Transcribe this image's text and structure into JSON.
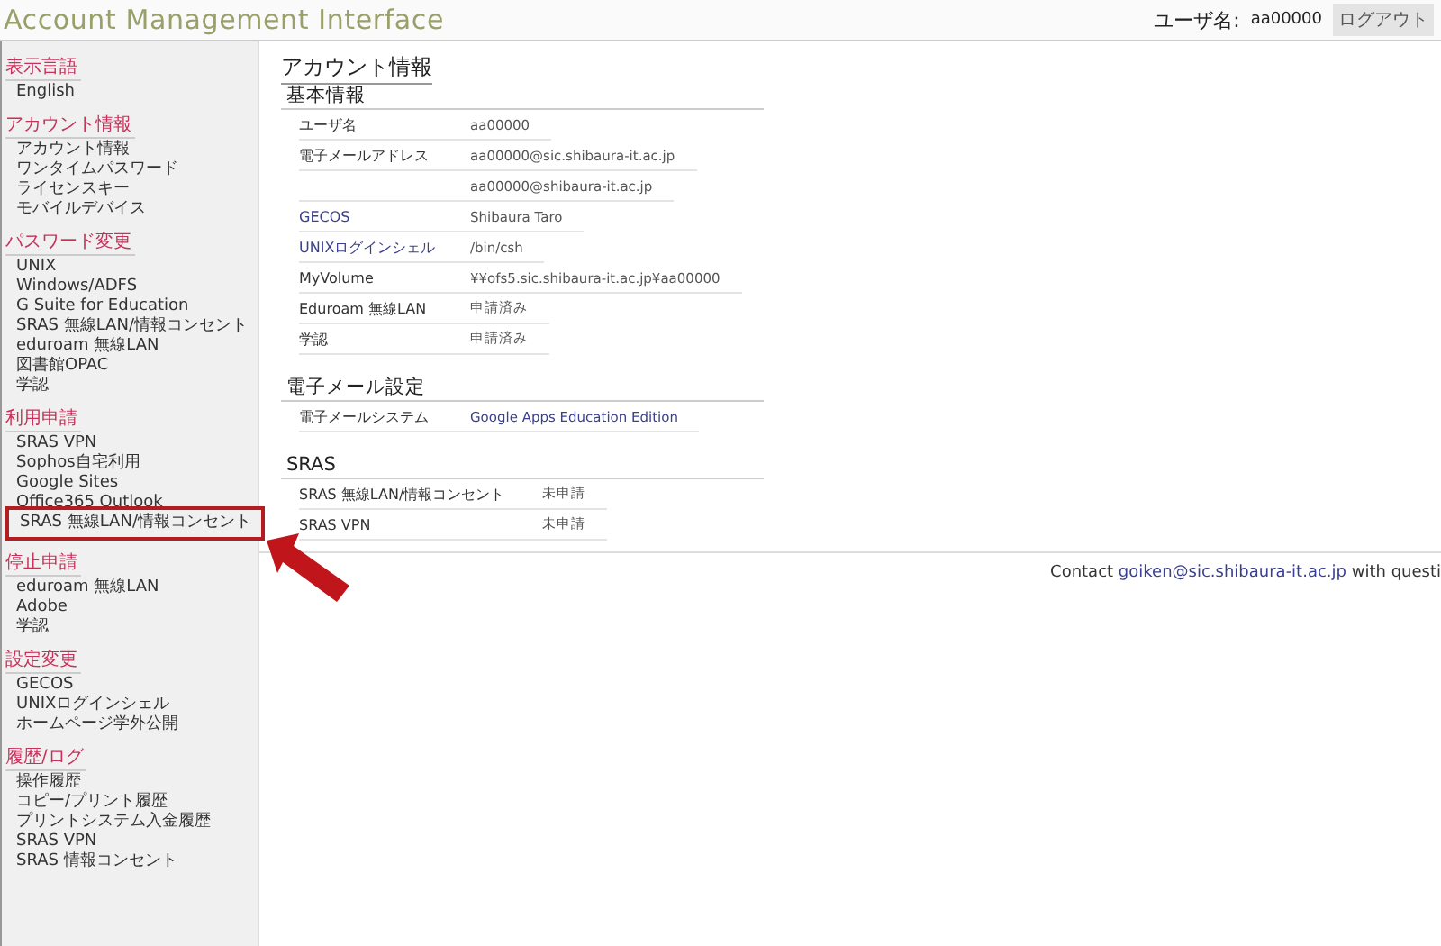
{
  "header": {
    "title": "Account Management Interface",
    "user_label": "ユーザ名:",
    "user_value": "aa00000",
    "logout": "ログアウト"
  },
  "sidebar": {
    "sections": [
      {
        "heading": "表示言語",
        "items": [
          {
            "label": "English",
            "highlighted": false
          }
        ]
      },
      {
        "heading": "アカウント情報",
        "items": [
          {
            "label": "アカウント情報",
            "highlighted": false
          },
          {
            "label": "ワンタイムパスワード",
            "highlighted": false
          },
          {
            "label": "ライセンスキー",
            "highlighted": false
          },
          {
            "label": "モバイルデバイス",
            "highlighted": false
          }
        ]
      },
      {
        "heading": "パスワード変更",
        "items": [
          {
            "label": "UNIX",
            "highlighted": false
          },
          {
            "label": "Windows/ADFS",
            "highlighted": false
          },
          {
            "label": "G Suite for Education",
            "highlighted": false
          },
          {
            "label": "SRAS 無線LAN/情報コンセント",
            "highlighted": false
          },
          {
            "label": "eduroam 無線LAN",
            "highlighted": false
          },
          {
            "label": "図書館OPAC",
            "highlighted": false
          },
          {
            "label": "学認",
            "highlighted": false
          }
        ]
      },
      {
        "heading": "利用申請",
        "items": [
          {
            "label": "SRAS VPN",
            "highlighted": false
          },
          {
            "label": "Sophos自宅利用",
            "highlighted": false
          },
          {
            "label": "Google Sites",
            "highlighted": false
          },
          {
            "label": "Office365 Outlook",
            "highlighted": false
          },
          {
            "label": "SRAS 無線LAN/情報コンセント",
            "highlighted": true
          }
        ]
      },
      {
        "heading": "停止申請",
        "items": [
          {
            "label": "eduroam 無線LAN",
            "highlighted": false
          },
          {
            "label": "Adobe",
            "highlighted": false
          },
          {
            "label": "学認",
            "highlighted": false
          }
        ]
      },
      {
        "heading": "設定変更",
        "items": [
          {
            "label": "GECOS",
            "highlighted": false
          },
          {
            "label": "UNIXログインシェル",
            "highlighted": false
          },
          {
            "label": "ホームページ学外公開",
            "highlighted": false
          }
        ]
      },
      {
        "heading": "履歴/ログ",
        "items": [
          {
            "label": "操作履歴",
            "highlighted": false
          },
          {
            "label": "コピー/プリント履歴",
            "highlighted": false
          },
          {
            "label": "プリントシステム入金履歴",
            "highlighted": false
          },
          {
            "label": "SRAS VPN",
            "highlighted": false
          },
          {
            "label": "SRAS 情報コンセント",
            "highlighted": false
          }
        ]
      }
    ]
  },
  "main": {
    "title": "アカウント情報",
    "sections": [
      {
        "heading": "基本情報",
        "rows": [
          {
            "label": "ユーザ名",
            "value": "aa00000",
            "label_link": false,
            "value_link": false
          },
          {
            "label": "電子メールアドレス",
            "value": "aa00000@sic.shibaura-it.ac.jp",
            "label_link": false,
            "value_link": false
          },
          {
            "value": "aa00000@shibaura-it.ac.jp",
            "value_link": false
          },
          {
            "label": "GECOS",
            "value": "Shibaura Taro",
            "label_link": true,
            "value_link": false
          },
          {
            "label": "UNIXログインシェル",
            "value": "/bin/csh",
            "label_link": true,
            "value_link": false
          },
          {
            "label": "MyVolume",
            "value": "¥¥ofs5.sic.shibaura-it.ac.jp¥aa00000",
            "label_link": false,
            "value_link": false
          },
          {
            "label": "Eduroam 無線LAN",
            "value": "申請済み",
            "label_link": false,
            "value_link": false
          },
          {
            "label": "学認",
            "value": "申請済み",
            "label_link": false,
            "value_link": false
          }
        ]
      },
      {
        "heading": "電子メール設定",
        "rows": [
          {
            "label": "電子メールシステム",
            "value": "Google Apps Education Edition",
            "label_link": false,
            "value_link": true
          }
        ]
      },
      {
        "heading": "SRAS",
        "rows": [
          {
            "label": "SRAS 無線LAN/情報コンセント",
            "value": "未申請",
            "label_link": false,
            "value_link": false
          },
          {
            "label": "SRAS VPN",
            "value": "未申請",
            "label_link": false,
            "value_link": false
          }
        ]
      }
    ]
  },
  "footer": {
    "prefix": "Contact",
    "email": "goiken@sic.shibaura-it.ac.jp",
    "suffix": "with questi"
  }
}
